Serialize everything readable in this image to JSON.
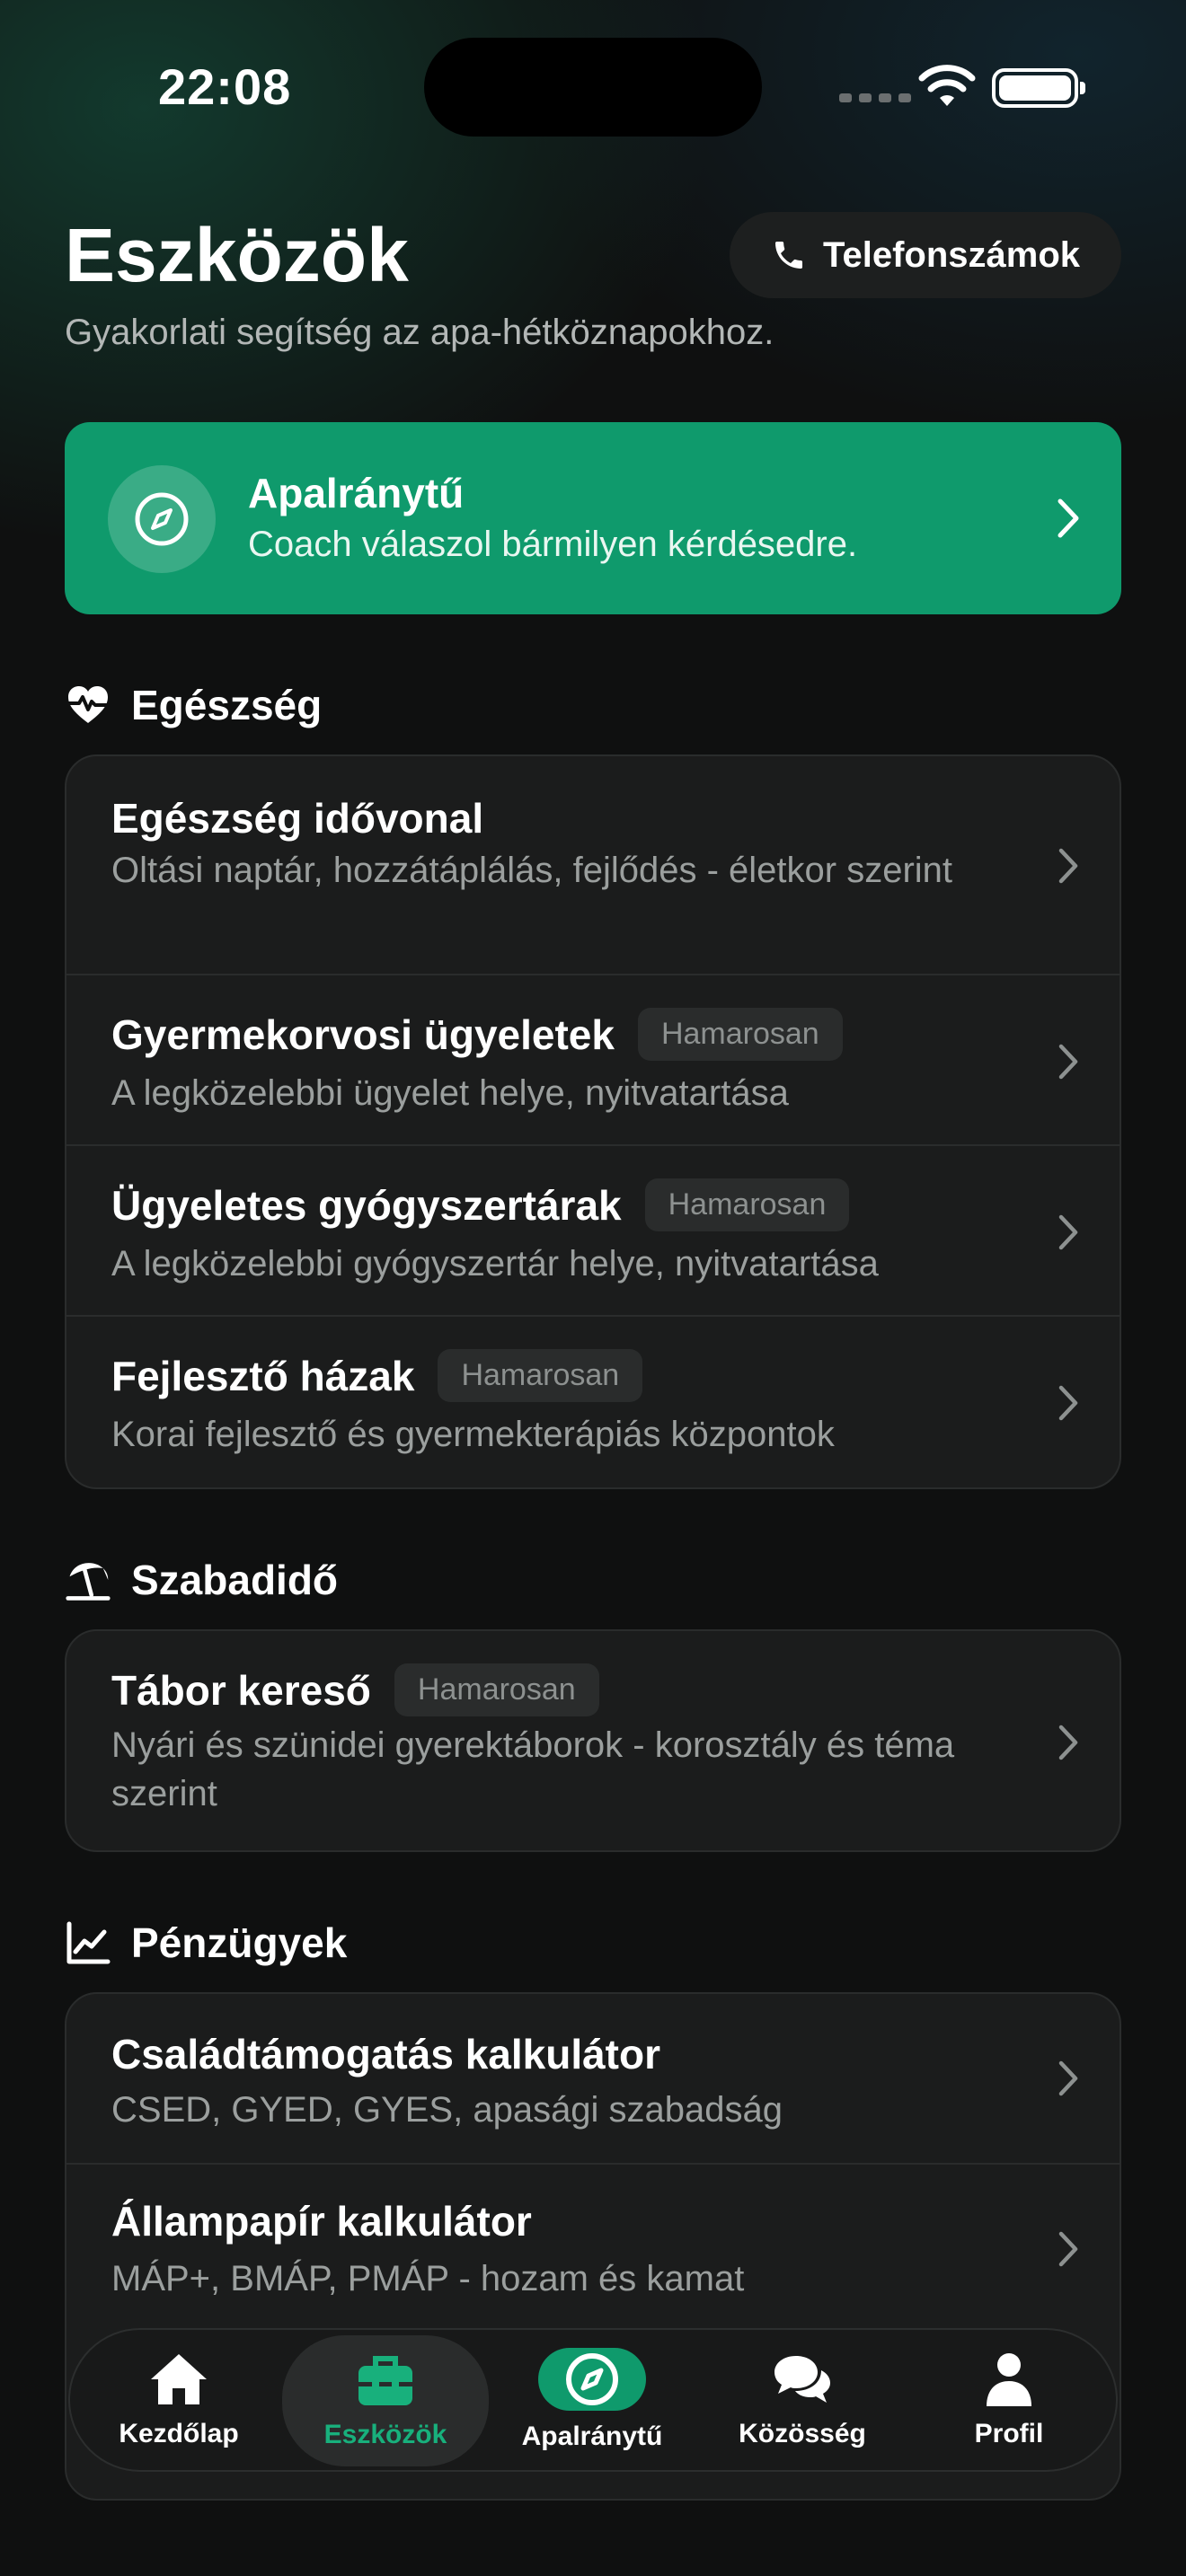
{
  "status": {
    "time": "22:08"
  },
  "header": {
    "title": "Eszközök",
    "subtitle": "Gyakorlati segítség az apa-hétköznapokhoz.",
    "phone_button": "Telefonszámok"
  },
  "coach": {
    "title": "Apalránytű",
    "subtitle": "Coach válaszol bármilyen kérdésedre."
  },
  "sections": [
    {
      "title": "Egészség",
      "icon": "heart-pulse-icon",
      "items": [
        {
          "title": "Egészség idővonal",
          "subtitle": "Oltási naptár, hozzátáplálás, fejlődés - életkor szerint",
          "badge": ""
        },
        {
          "title": "Gyermekorvosi ügyeletek",
          "subtitle": "A legközelebbi ügyelet helye, nyitvatartása",
          "badge": "Hamarosan"
        },
        {
          "title": "Ügyeletes gyógyszertárak",
          "subtitle": "A legközelebbi gyógyszertár helye, nyitvatartása",
          "badge": "Hamarosan"
        },
        {
          "title": "Fejlesztő házak",
          "subtitle": "Korai fejlesztő és gyermekterápiás központok",
          "badge": "Hamarosan"
        }
      ]
    },
    {
      "title": "Szabadidő",
      "icon": "beach-umbrella-icon",
      "items": [
        {
          "title": "Tábor kereső",
          "subtitle": "Nyári és szünidei gyerektáborok - korosztály és téma szerint",
          "badge": "Hamarosan"
        }
      ]
    },
    {
      "title": "Pénzügyek",
      "icon": "chart-line-icon",
      "items": [
        {
          "title": "Családtámogatás kalkulátor",
          "subtitle": "CSED, GYED, GYES, apasági szabadság",
          "badge": ""
        },
        {
          "title": "Állampapír kalkulátor",
          "subtitle": "MÁP+, BMÁP, PMÁP - hozam és kamat",
          "badge": ""
        }
      ]
    }
  ],
  "tabbar": {
    "home": "Kezdőlap",
    "tools": "Eszközök",
    "coach": "Apalránytű",
    "community": "Közösség",
    "profile": "Profil"
  },
  "colors": {
    "accent": "#0f9a6c",
    "accent_text": "#18b07c",
    "background": "#0f1010",
    "card": "#1b1c1c"
  }
}
